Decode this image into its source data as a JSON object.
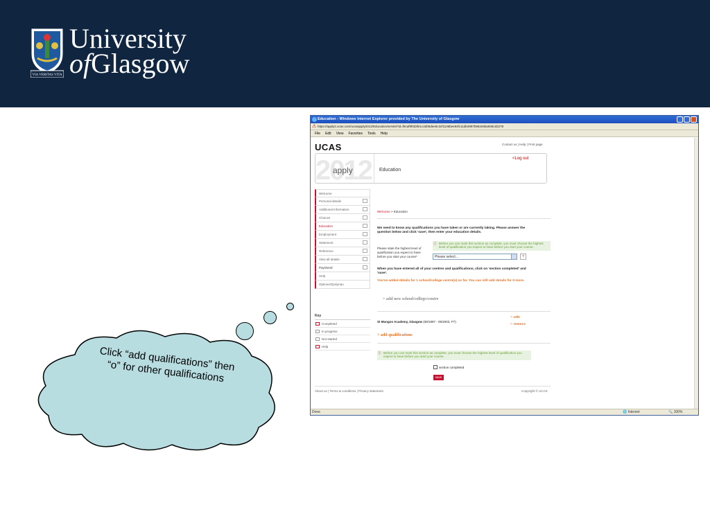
{
  "banner": {
    "name_line1": "University",
    "name_of": "of",
    "name_line2": "Glasgow",
    "crest_motto": "VIA VERITAS VITA",
    "bg_color": "#0f2540"
  },
  "callout": {
    "text": "Click “add qualifications” then “o” for other qualifications",
    "fill_color": "#b7dde1"
  },
  "browser": {
    "title": "Education - Windows Internet Explorer provided by The University of Glasgow",
    "address": "https://apply2.ucas.com/ucasapply2012/EducationServlet?id=f9caf9f0d3fe1c4d05dee5c3cf1106bee94fc11db4997b962e5ba936cd2278",
    "menu": [
      "File",
      "Edit",
      "View",
      "Favorites",
      "Tools",
      "Help"
    ],
    "status_left": "Done",
    "status_zone": "Internet",
    "status_zoom": "100%"
  },
  "page": {
    "logo": "UCAS",
    "top_links": "Contact us | Help | Print page",
    "hero_year": "2012",
    "hero_apply": "apply",
    "hero_title": "Education",
    "logout": "<Log out",
    "nav": [
      {
        "label": "Welcome",
        "box": false
      },
      {
        "label": "Personal details",
        "box": true
      },
      {
        "label": "Additional Information",
        "box": true
      },
      {
        "label": "Choices",
        "box": true
      },
      {
        "label": "Education",
        "box": true
      },
      {
        "label": "Employment",
        "box": true
      },
      {
        "label": "Statement",
        "box": true
      },
      {
        "label": "Reference",
        "box": true
      },
      {
        "label": "View all details",
        "box": true
      },
      {
        "label": "Pay/Send",
        "box": true
      },
      {
        "label": "Help",
        "box": false
      },
      {
        "label": "Options/Opsiynau",
        "box": false
      }
    ],
    "key_title": "Key",
    "key": [
      "Completed",
      "In progress",
      "Not started",
      "Help"
    ],
    "breadcrumb_link": "Welcome",
    "breadcrumb_current": " > Education",
    "intro": "We need to know any qualifications you have taken or are currently taking. Please answer the question below and click 'save', then enter your education details.",
    "warning1": "Before you can mark this section as complete, you must choose the highest level of qualification you expect to have before you start your course.",
    "question": "Please state the highest level of qualification you expect to have before you start your course*",
    "select_value": "Please select...",
    "help_glyph": "?",
    "entered_note": "When you have entered all of your centres and qualifications, click on 'section completed' and 'save'.",
    "added_note": "You've added details for 1 school/college centre(s) so far. You can still add details for 9 more.",
    "add_school": "> add new school/college/centre",
    "school_name": "St Mungos Academy, Glasgow",
    "school_dates": " (08/1997 - 06/2003, FT)",
    "edit": "> edit",
    "remove": "> remove",
    "add_qualifications": "> add qualifications",
    "warning2": "Before you can mark this section as complete, you must choose the highest level of qualification you expect to have before you start your course.",
    "section_completed": "section completed",
    "save": "save",
    "footer_links": "About us | Terms & conditions | Privacy statement",
    "copyright": "Copyright © UCAS"
  }
}
